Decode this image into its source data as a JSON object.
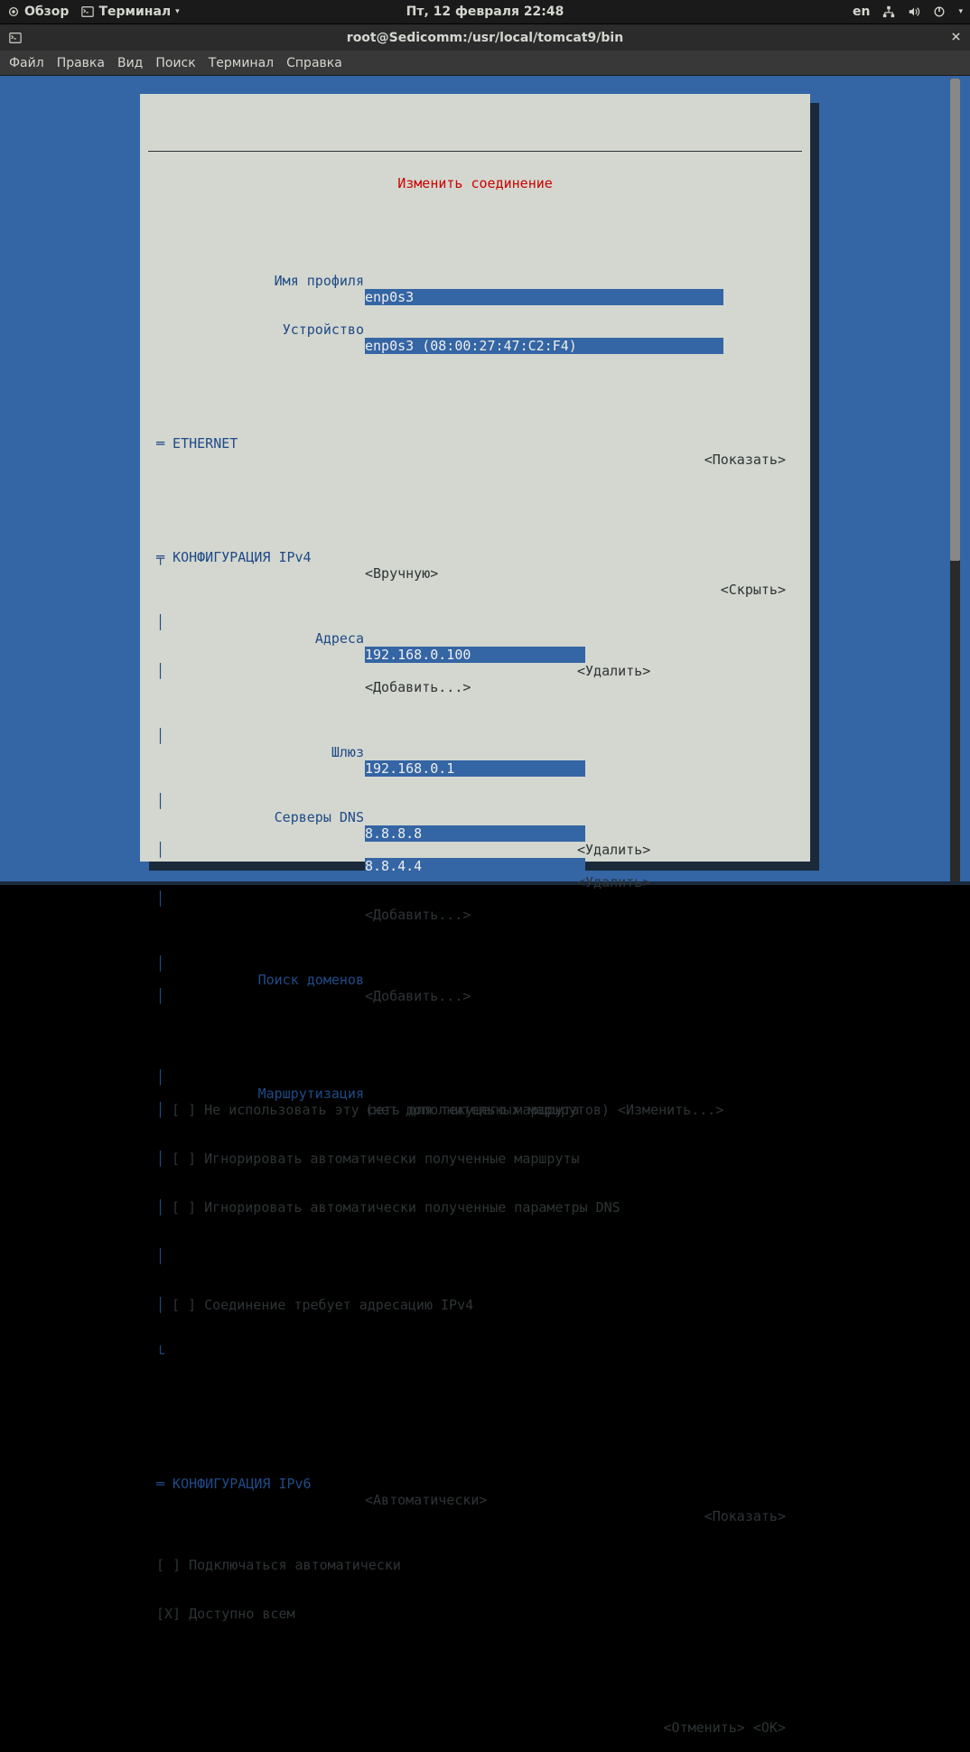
{
  "topbar": {
    "overview": "Обзор",
    "terminal": "Терминал",
    "datetime": "Пт, 12 февраля  22:48",
    "lang": "en"
  },
  "window": {
    "title": "root@Sedicomm:/usr/local/tomcat9/bin"
  },
  "menubar": {
    "file": "Файл",
    "edit": "Правка",
    "view": "Вид",
    "search": "Поиск",
    "terminal": "Терминал",
    "help": "Справка"
  },
  "tui": {
    "title": " Изменить соединение ",
    "profile_name_label": "Имя профиля",
    "profile_name_value": "enp0s3                                      ",
    "device_label": "Устройство",
    "device_value": "enp0s3 (08:00:27:47:C2:F4)                  ",
    "ethernet_section": "═ ETHERNET",
    "show_action": "<Показать>",
    "hide_action": "<Скрыть>",
    "ipv4_section": "КОНФИГУРАЦИЯ IPv4",
    "ipv4_mode": "<Вручную>",
    "addresses_label": "Адреса",
    "address1": "192.168.0.100              ",
    "delete_action": "<Удалить>",
    "add_action": "<Добавить...>",
    "gateway_label": "Шлюз",
    "gateway_value": "192.168.0.1                ",
    "dns_label": "Серверы DNS",
    "dns1": "8.8.8.8                    ",
    "dns2": "8.8.4.4                    ",
    "domain_search_label": "Поиск доменов",
    "routing_label": "Маршрутизация",
    "routing_value": "(нет дополнительных маршрутов) <Изменить...>",
    "cb1": "[ ] Не использовать эту сеть для текущего маршрута",
    "cb2": "[ ] Игнорировать автоматически полученные маршруты",
    "cb3": "[ ] Игнорировать автоматически полученные параметры DNS",
    "cb4": "[ ] Соединение требует адресацию IPv4",
    "ipv6_section": "═ КОНФИГУРАЦИЯ IPv6",
    "ipv6_mode": "<Автоматически>",
    "cb5": "[ ] Подключаться автоматически",
    "cb6": "[X] Доступно всем",
    "cancel": "<Отменить>",
    "ok": "<OK>"
  }
}
